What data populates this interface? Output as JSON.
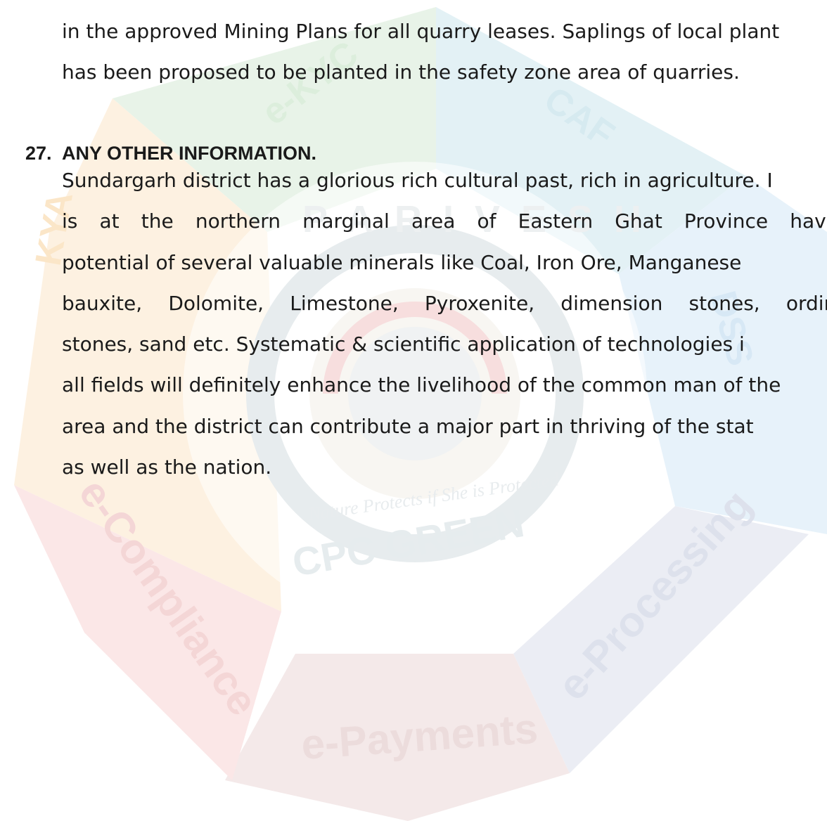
{
  "document": {
    "top_paragraph_lines": [
      "in the approved Mining Plans for all quarry leases. Saplings of local plant",
      "has been proposed to be planted in the safety zone area of quarries."
    ],
    "section": {
      "number": "27.",
      "title": "ANY OTHER INFORMATION."
    },
    "body_lines": [
      "Sundargarh district has a glorious rich cultural past, rich in agriculture. I",
      "is  at  the  northern  marginal  area  of  Eastern  Ghat  Province  having",
      "potential of several valuable minerals like Coal, Iron Ore, Manganese",
      "bauxite,  Dolomite,  Limestone,  Pyroxenite,  dimension  stones,  ordinar",
      "stones, sand etc. Systematic & scientific application of technologies i",
      "all fields will definitely enhance the livelihood of the common man of the",
      "area and the district can contribute a major part in thriving of the stat",
      "as well as the nation."
    ]
  },
  "watermark": {
    "segments": [
      "e-KYC",
      "CAF",
      "DSS",
      "e-Processing",
      "e-Payments",
      "e-Compliance",
      "KYA"
    ],
    "center_ring_text": "PARIVESH",
    "motto": "Nature Protects if She is Protected",
    "brand": "CPC GREEN",
    "colors": {
      "ekyc": "#e6f2e6",
      "caf": "#e4f1f6",
      "dss": "#e5f1fa",
      "eprocessing": "#eaecf3",
      "epayments": "#f3e8e8",
      "ecompliance": "#fae6e6",
      "kya": "#fdf0df"
    }
  }
}
